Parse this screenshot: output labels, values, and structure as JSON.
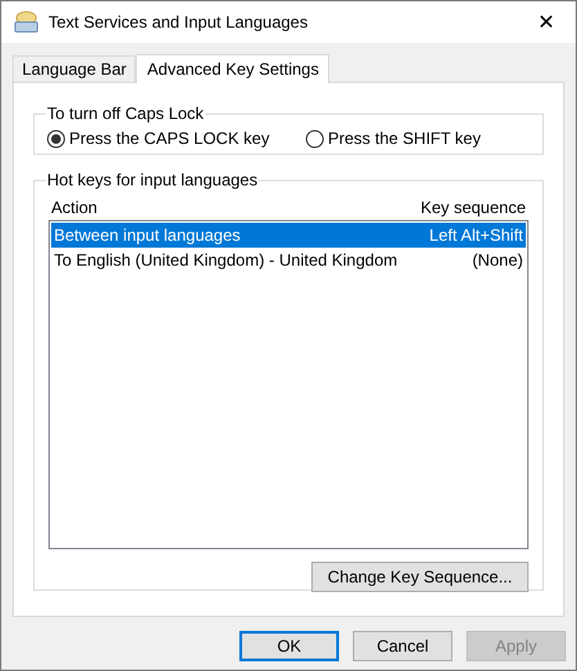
{
  "window": {
    "title": "Text Services and Input Languages",
    "close": "✕"
  },
  "tabs": [
    {
      "label": "Language Bar",
      "selected": false
    },
    {
      "label": "Advanced Key Settings",
      "selected": true
    }
  ],
  "caps_lock": {
    "title": "To turn off Caps Lock",
    "options": [
      {
        "label": "Press the CAPS LOCK key",
        "selected": true
      },
      {
        "label": "Press the SHIFT key",
        "selected": false
      }
    ]
  },
  "hot_keys": {
    "title": "Hot keys for input languages",
    "columns": [
      "Action",
      "Key sequence"
    ],
    "rows": [
      {
        "action": "Between input languages",
        "key_sequence": "Left Alt+Shift",
        "selected": true
      },
      {
        "action": "To English (United Kingdom) - United Kingdom",
        "key_sequence": "(None)",
        "selected": false
      }
    ],
    "button": "Change Key Sequence..."
  },
  "buttons": [
    {
      "label": "OK",
      "default": true,
      "disabled": false
    },
    {
      "label": "Cancel",
      "default": false,
      "disabled": false
    },
    {
      "label": "Apply",
      "default": false,
      "disabled": true
    }
  ]
}
